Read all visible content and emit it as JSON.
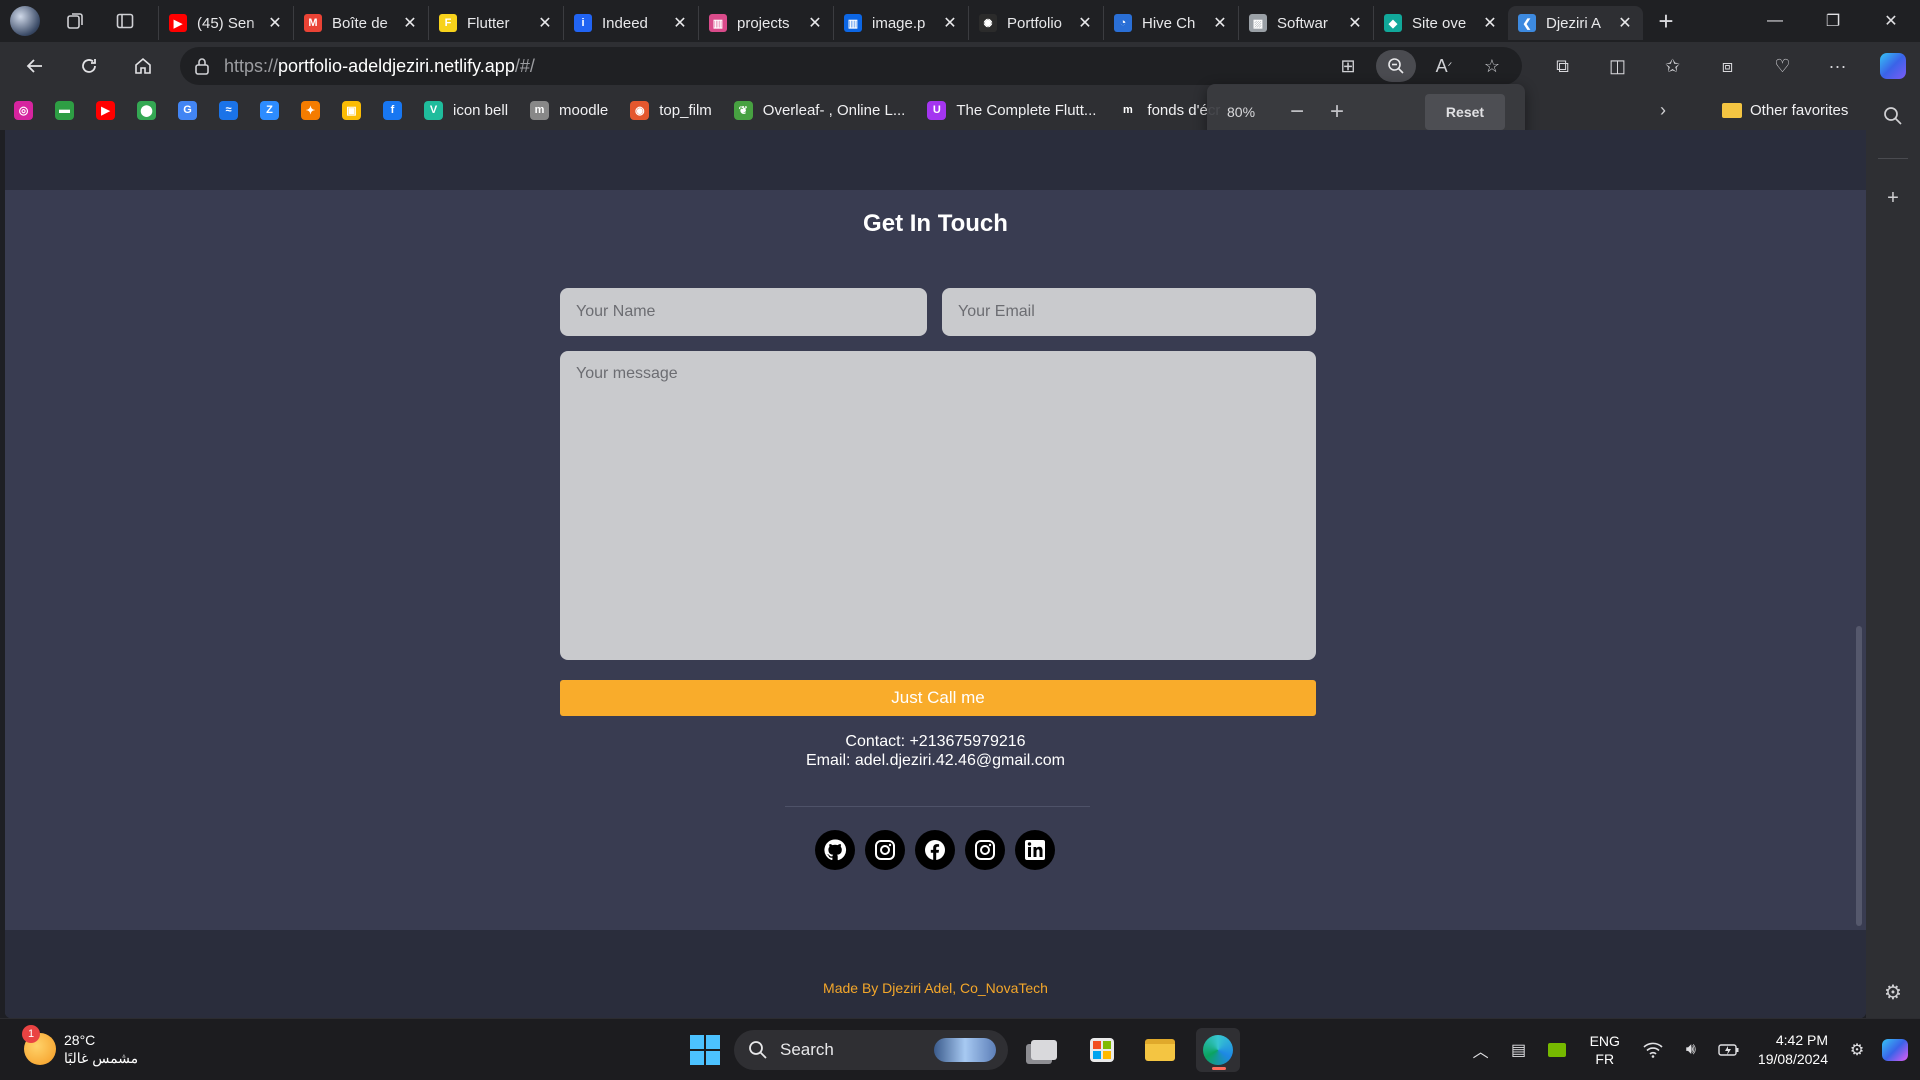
{
  "browser": {
    "tabs": [
      {
        "title": "(45) Sen",
        "icon": "youtube-icon",
        "color": "#ff0000",
        "glyph": "▶"
      },
      {
        "title": "Boîte de",
        "icon": "gmail-icon",
        "color": "#ea4335",
        "glyph": "M"
      },
      {
        "title": "Flutter",
        "icon": "flutter-tab-icon",
        "color": "#f7d21b",
        "glyph": "F"
      },
      {
        "title": "Indeed",
        "icon": "indeed-icon",
        "color": "#2164f3",
        "glyph": "i"
      },
      {
        "title": "projects",
        "icon": "trello-pink-icon",
        "color": "#d94b8a",
        "glyph": "▥"
      },
      {
        "title": "image.p",
        "icon": "trello-icon",
        "color": "#0c66e4",
        "glyph": "▥"
      },
      {
        "title": "Portfolio",
        "icon": "chatgpt-icon",
        "color": "#2b2b2b",
        "glyph": "✺"
      },
      {
        "title": "Hive Ch",
        "icon": "hive-icon",
        "color": "#2a6fd6",
        "glyph": "◔"
      },
      {
        "title": "Softwar",
        "icon": "software-icon",
        "color": "#9aa0a6",
        "glyph": "▨"
      },
      {
        "title": "Site ove",
        "icon": "site-diamond-icon",
        "color": "#11a89a",
        "glyph": "◆"
      },
      {
        "title": "Djeziri A",
        "icon": "flutter-icon",
        "color": "#3d8ae0",
        "glyph": "❮",
        "active": true
      }
    ],
    "url_prefix": "https://",
    "url_host": "portfolio-adeldjeziri.netlify.app",
    "url_path": "/#/",
    "favorites": [
      {
        "label": "",
        "icon": "instagram-icon",
        "color": "#d6249f",
        "glyph": "◎"
      },
      {
        "label": "",
        "icon": "green-bar-icon",
        "color": "#2e9e44",
        "glyph": "▬"
      },
      {
        "label": "",
        "icon": "youtube-icon",
        "color": "#ff0000",
        "glyph": "▶"
      },
      {
        "label": "",
        "icon": "maps-icon",
        "color": "#34a853",
        "glyph": "⬤"
      },
      {
        "label": "",
        "icon": "translate-icon",
        "color": "#4285f4",
        "glyph": "G"
      },
      {
        "label": "",
        "icon": "blue-app-icon",
        "color": "#1a73e8",
        "glyph": "≈"
      },
      {
        "label": "",
        "icon": "zoom-icon",
        "color": "#2d8cff",
        "glyph": "Z"
      },
      {
        "label": "",
        "icon": "fire-icon",
        "color": "#f57c00",
        "glyph": "✦"
      },
      {
        "label": "",
        "icon": "photos-icon",
        "color": "#fbbc04",
        "glyph": "▣"
      },
      {
        "label": "",
        "icon": "facebook-icon",
        "color": "#1877f2",
        "glyph": "f"
      },
      {
        "label": "icon bell",
        "icon": "vuetify-icon",
        "color": "#1fbc9c",
        "glyph": "V"
      },
      {
        "label": "moodle",
        "icon": "moodle-icon",
        "color": "#888888",
        "glyph": "m"
      },
      {
        "label": "top_film",
        "icon": "film-icon",
        "color": "#e4572e",
        "glyph": "◉"
      },
      {
        "label": "Overleaf- , Online L...",
        "icon": "overleaf-icon",
        "color": "#47a141",
        "glyph": "❦"
      },
      {
        "label": "The Complete Flutt...",
        "icon": "udemy-icon",
        "color": "#a435f0",
        "glyph": "U"
      },
      {
        "label": "fonds d'écr",
        "icon": "m-icon",
        "color": "#2e2f33",
        "glyph": "m"
      }
    ],
    "other_favorites": "Other favorites",
    "zoom_popup": {
      "percent": "80%",
      "reset_label": "Reset"
    }
  },
  "page": {
    "title": "Get In Touch",
    "name_placeholder": "Your Name",
    "email_placeholder": "Your Email",
    "message_placeholder": "Your message",
    "button_label": "Just Call me",
    "contact_line": "Contact: +213675979216",
    "email_line": "Email: adel.djeziri.42.46@gmail.com",
    "socials": [
      "github-icon",
      "instagram-icon",
      "facebook-icon",
      "instagram-icon",
      "linkedin-icon"
    ],
    "footer": "Made By Djeziri Adel, Co_NovaTech",
    "colors": {
      "background": "#393c51",
      "header": "#2a2d3c",
      "accent": "#f9ac2b",
      "input": "#c9cacd"
    }
  },
  "taskbar": {
    "temperature": "28°C",
    "weather_text": "مشمس غالبًا",
    "weather_badge": "1",
    "search_label": "Search",
    "lang_line1": "ENG",
    "lang_line2": "FR",
    "time": "4:42 PM",
    "date": "19/08/2024"
  }
}
